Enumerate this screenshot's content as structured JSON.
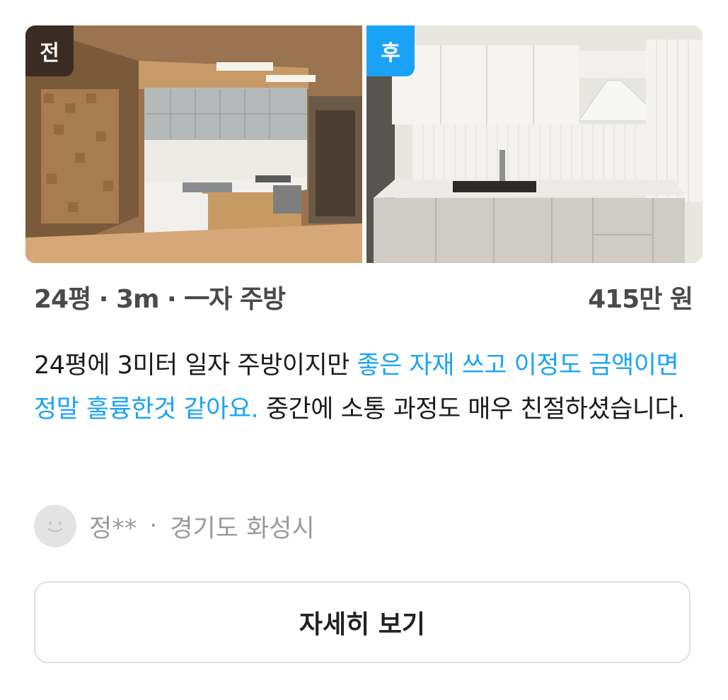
{
  "photos": {
    "before_tag": "전",
    "after_tag": "후"
  },
  "summary": {
    "specs": "24평 · 3m · 一자 주방",
    "price": "415만 원"
  },
  "review": {
    "part1": "24평에 3미터 일자 주방이지만 ",
    "highlight": "좋은 자재 쓰고 이정도 금액이면 정말 훌륭한것 같아요.",
    "part2": " 중간에 소통 과정도 매우 친절하셨습니다."
  },
  "author": {
    "name": "정**",
    "separator": "·",
    "location": "경기도 화성시"
  },
  "details_button": "자세히 보기",
  "colors": {
    "accent": "#1aa3f6",
    "before_tag_bg": "#3a2c22"
  }
}
